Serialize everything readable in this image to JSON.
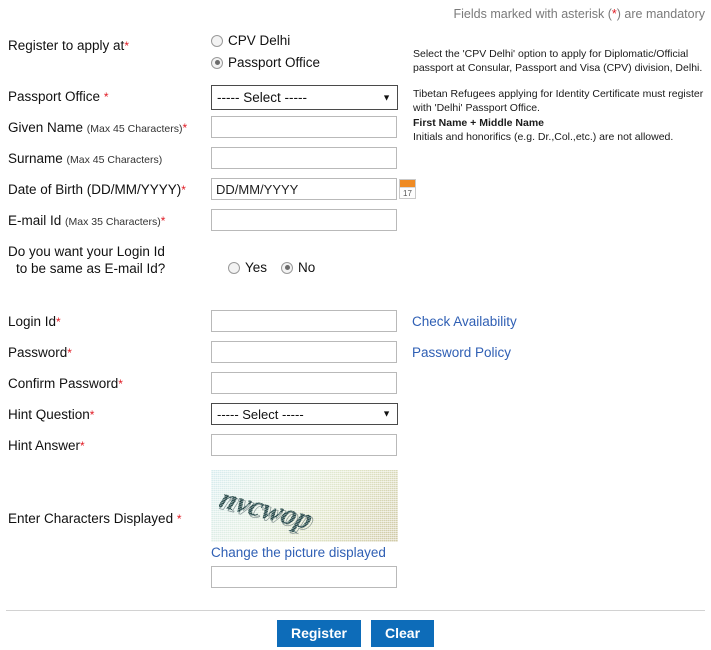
{
  "header": {
    "note_prefix": "Fields marked with asterisk (",
    "note_star": "*",
    "note_suffix": ") are mandatory"
  },
  "fields": {
    "register_at": {
      "label": "Register to apply at",
      "required": "*",
      "options": [
        {
          "label": "CPV Delhi",
          "selected": false
        },
        {
          "label": "Passport Office",
          "selected": true
        }
      ],
      "hint": "Select the 'CPV Delhi' option to apply for Diplomatic/Official passport at Consular, Passport and Visa (CPV) division, Delhi."
    },
    "passport_office": {
      "label": "Passport Office",
      "required": "*",
      "value": "----- Select -----",
      "hint": "Tibetan Refugees applying for Identity Certificate must register with 'Delhi' Passport Office."
    },
    "given_name": {
      "label": "Given Name",
      "sub": "(Max 45 Characters)",
      "required": "*",
      "value": "",
      "hint_bold": "First Name + Middle Name",
      "hint": "Initials and honorifics (e.g. Dr.,Col.,etc.) are not allowed."
    },
    "surname": {
      "label": "Surname",
      "sub": "(Max 45 Characters)",
      "required": "",
      "value": ""
    },
    "dob": {
      "label": "Date of Birth (DD/MM/YYYY)",
      "required": "*",
      "value": "DD/MM/YYYY",
      "calendar_day": "17"
    },
    "email": {
      "label": "E-mail Id",
      "sub": "(Max 35 Characters)",
      "required": "*",
      "value": ""
    },
    "login_same_as_email": {
      "label_line1": "Do you want your Login Id",
      "label_line2": "to be same as E-mail Id?",
      "options": [
        {
          "label": "Yes",
          "selected": false
        },
        {
          "label": "No",
          "selected": true
        }
      ]
    },
    "login_id": {
      "label": "Login Id",
      "required": "*",
      "value": "",
      "link": "Check Availability"
    },
    "password": {
      "label": "Password",
      "required": "*",
      "value": "",
      "link": "Password Policy"
    },
    "confirm_password": {
      "label": "Confirm Password",
      "required": "*",
      "value": ""
    },
    "hint_question": {
      "label": "Hint Question",
      "required": "*",
      "value": "----- Select -----"
    },
    "hint_answer": {
      "label": "Hint Answer",
      "required": "*",
      "value": ""
    },
    "captcha": {
      "label": "Enter Characters Displayed",
      "required": "*",
      "image_text": "nvcwop",
      "change_link": "Change the picture displayed",
      "value": ""
    }
  },
  "buttons": {
    "register": "Register",
    "clear": "Clear"
  },
  "colors": {
    "required_star": "#e01b24",
    "link": "#2f5fb4",
    "button": "#0d6cb9",
    "calendar_bar": "#ef8b24"
  }
}
